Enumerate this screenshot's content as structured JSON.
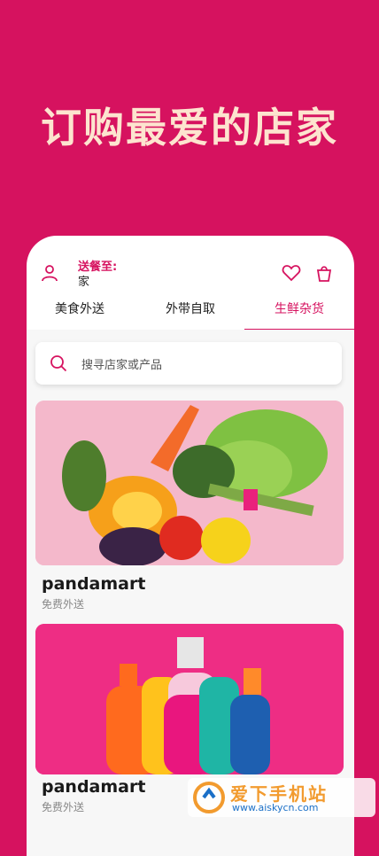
{
  "hero": {
    "title": "订购最爱的店家"
  },
  "header": {
    "deliver_label": "送餐至:",
    "deliver_value": "家",
    "icons": [
      "user-icon",
      "heart-icon",
      "bag-icon"
    ]
  },
  "tabs": [
    {
      "label": "美食外送",
      "active": false
    },
    {
      "label": "外带自取",
      "active": false
    },
    {
      "label": "生鲜杂货",
      "active": true
    }
  ],
  "search": {
    "placeholder": "搜寻店家或产品"
  },
  "stores": [
    {
      "name": "pandamart",
      "subtitle": "免费外送"
    },
    {
      "name": "pandamart",
      "subtitle": "免费外送"
    }
  ],
  "watermark": {
    "title": "爱下手机站",
    "url": "www.aiskycn.com"
  },
  "colors": {
    "brand": "#d6125f",
    "hero_text": "#fde4cf"
  }
}
